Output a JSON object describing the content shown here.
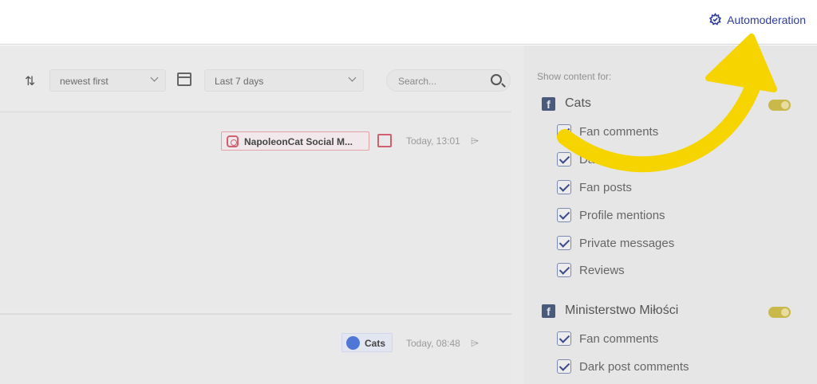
{
  "topbar": {
    "automoderation_label": "Automoderation",
    "accent_color": "#2f3d9c"
  },
  "toolbar": {
    "sort_value": "newest first",
    "date_value": "Last 7 days",
    "search_placeholder": "Search..."
  },
  "posts": [
    {
      "source_label": "NapoleonCat Social M...",
      "source_icon": "instagram-icon",
      "time": "Today, 13:01"
    },
    {
      "source_label": "Cats",
      "source_icon": "messenger-icon",
      "time": "Today, 08:48"
    }
  ],
  "actions": {
    "more": "•••",
    "icons": [
      "trash-icon",
      "hide-icon",
      "reply-icon",
      "resolve-icon"
    ]
  },
  "sidebar": {
    "title": "Show content for:",
    "pages": [
      {
        "name": "Cats",
        "enabled": true,
        "options": [
          "Fan comments",
          "Dark post comments",
          "Fan posts",
          "Profile mentions",
          "Private messages",
          "Reviews"
        ]
      },
      {
        "name": "Ministerstwo Miłości",
        "enabled": true,
        "options": [
          "Fan comments",
          "Dark post comments"
        ]
      }
    ]
  },
  "highlight_color": "#f5d400"
}
